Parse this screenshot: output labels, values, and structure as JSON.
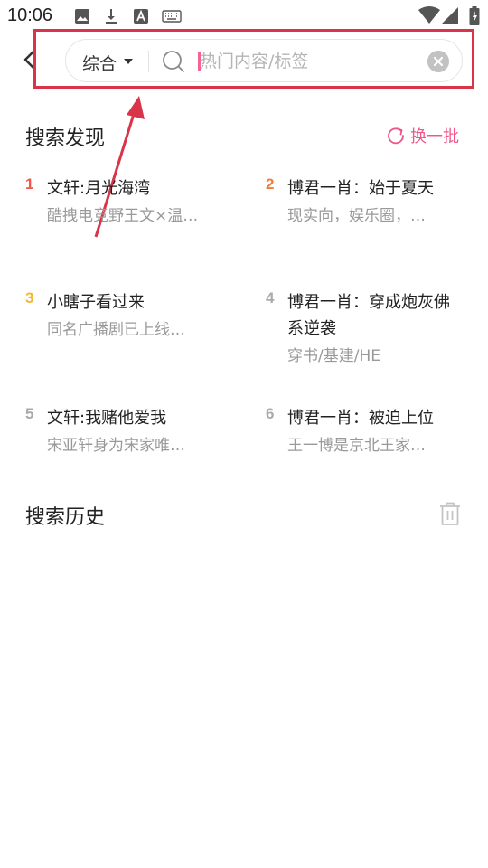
{
  "status_bar": {
    "time": "10:06",
    "icons": [
      "image-icon",
      "download-icon",
      "text-a-icon",
      "keyboard-icon"
    ],
    "right_icons": [
      "wifi-icon",
      "signal-icon",
      "battery-icon"
    ]
  },
  "header": {
    "scope_label": "综合",
    "placeholder": "热门内容/标签"
  },
  "discover": {
    "title": "搜索发现",
    "refresh_label": "换一批",
    "items": [
      {
        "rank": "1",
        "title": "文轩:月光海湾",
        "desc": "酷拽电竞野王文×温…",
        "rank_color": "#f2564b"
      },
      {
        "rank": "2",
        "title": "博君一肖：始于夏天",
        "desc": "现实向，娱乐圈，…",
        "rank_color": "#f07b3b"
      },
      {
        "rank": "3",
        "title": "小瞎子看过来",
        "desc": "同名广播剧已上线…",
        "rank_color": "#f5b731"
      },
      {
        "rank": "4",
        "title": "博君一肖：穿成炮灰佛系逆袭",
        "desc": "穿书/基建/HE",
        "rank_color": "#aaaaaa"
      },
      {
        "rank": "5",
        "title": "文轩:我赌他爱我",
        "desc": "宋亚轩身为宋家唯…",
        "rank_color": "#aaaaaa"
      },
      {
        "rank": "6",
        "title": "博君一肖：被迫上位",
        "desc": "王一博是京北王家…",
        "rank_color": "#aaaaaa"
      }
    ]
  },
  "history": {
    "title": "搜索历史"
  },
  "colors": {
    "accent": "#f0568b",
    "annotation": "#d9344a"
  }
}
